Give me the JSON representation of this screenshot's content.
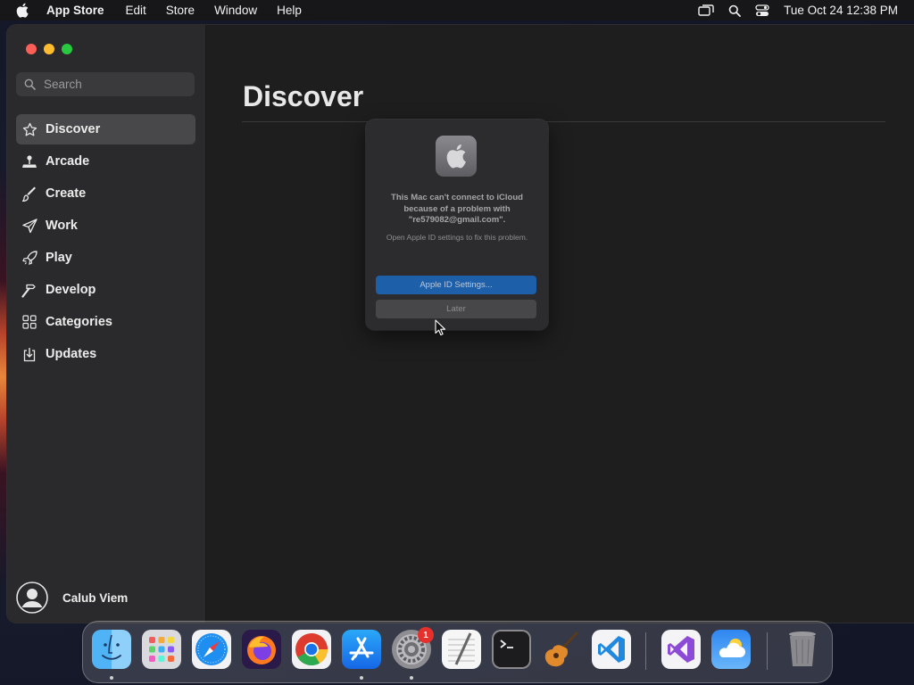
{
  "menubar": {
    "app_name": "App Store",
    "menus": [
      "Edit",
      "Store",
      "Window",
      "Help"
    ],
    "clock": "Tue Oct 24  12:38 PM",
    "icons": [
      "screen-mirroring-icon",
      "spotlight-search-icon",
      "control-center-icon"
    ]
  },
  "sidebar": {
    "search_placeholder": "Search",
    "items": [
      {
        "label": "Discover",
        "icon": "star-icon",
        "active": true
      },
      {
        "label": "Arcade",
        "icon": "joystick-icon"
      },
      {
        "label": "Create",
        "icon": "brush-icon"
      },
      {
        "label": "Work",
        "icon": "paper-plane-icon"
      },
      {
        "label": "Play",
        "icon": "rocket-icon"
      },
      {
        "label": "Develop",
        "icon": "hammer-icon"
      },
      {
        "label": "Categories",
        "icon": "grid-icon"
      },
      {
        "label": "Updates",
        "icon": "download-icon"
      }
    ],
    "user_name": "Calub Viem"
  },
  "main": {
    "title": "Discover"
  },
  "dialog": {
    "message": "This Mac can't connect to iCloud because of a problem with \"re579082@gmail.com\".",
    "submessage": "Open Apple ID settings to fix this problem.",
    "primary_button": "Apple ID Settings...",
    "secondary_button": "Later"
  },
  "dock": {
    "apps": [
      "Finder",
      "Launchpad",
      "Safari",
      "Firefox",
      "Google Chrome",
      "App Store",
      "System Settings",
      "TextEdit",
      "Terminal",
      "GarageBand",
      "Visual Studio Code",
      "Visual Studio",
      "Weather",
      "Trash"
    ],
    "settings_badge": "1"
  },
  "colors": {
    "close": "#ff5f57",
    "minimize": "#febc2e",
    "zoom": "#28c840",
    "accent": "#1d5fa8"
  }
}
